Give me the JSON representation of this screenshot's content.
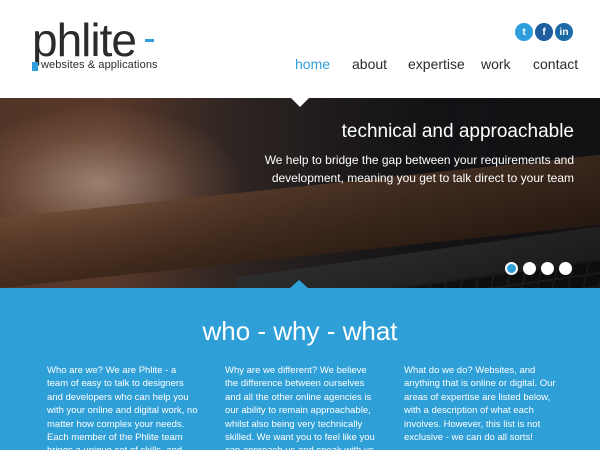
{
  "brand": {
    "name": "phlite",
    "tagline": "websites & applications",
    "accent_color": "#2f9fd8"
  },
  "social": [
    {
      "icon": "twitter-icon",
      "glyph": "t"
    },
    {
      "icon": "facebook-icon",
      "glyph": "f"
    },
    {
      "icon": "linkedin-icon",
      "glyph": "in"
    }
  ],
  "nav": {
    "items": [
      {
        "label": "home",
        "active": true
      },
      {
        "label": "about",
        "active": false
      },
      {
        "label": "expertise",
        "active": false
      },
      {
        "label": "work",
        "active": false
      },
      {
        "label": "contact",
        "active": false
      }
    ]
  },
  "hero": {
    "title": "technical and approachable",
    "text": "We help to bridge the gap between your requirements and development, meaning you get to talk direct to your team",
    "slides": 4,
    "active_slide": 1
  },
  "section": {
    "title": "who - why - what",
    "columns": [
      {
        "text": "Who are we? We are Phlite - a team of easy to talk to designers and developers who can help you with your online and digital work, no matter how complex your needs. Each member of the Phlite team brings a unique set of skills, and together we will deliver an"
      },
      {
        "text": "Why are we different? We believe the difference between ourselves and all the other online agencies is our ability to remain approachable, whilst also being very technically skilled. We want you to feel like you can approach us and speak with us whenever you need"
      },
      {
        "text": "What do we do? Websites, and anything that is online or digital. Our areas of expertise are listed below, with a description of what each involves. However, this list is not exclusive - we can do all sorts!"
      }
    ]
  }
}
